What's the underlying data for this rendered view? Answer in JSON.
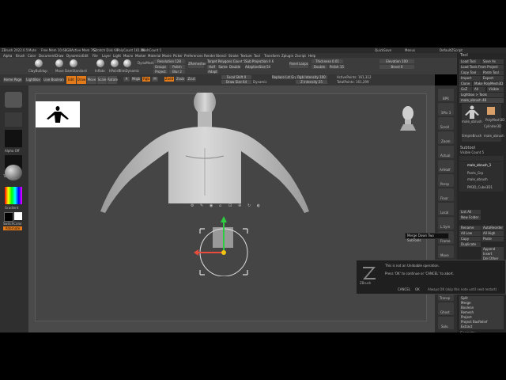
{
  "title_bar": {
    "app": "ZBrush 2022.0.5",
    "items": [
      "Mute",
      "Free Mem 10.68GB",
      "Active Mem 763",
      "Scratch Disk 69",
      "PolyCount 161.5K",
      "MeshCount 1"
    ],
    "right_items": [
      "QuickSave",
      "Menus",
      "DefaultZScript"
    ]
  },
  "menu_bar": {
    "items": [
      "Alpha",
      "Brush",
      "Color",
      "Document",
      "Draw",
      "Dynamics",
      "Edit",
      "File",
      "Layer",
      "Light",
      "Macro",
      "Marker",
      "Material",
      "Movie",
      "Picker",
      "Preferences",
      "Render",
      "Stencil",
      "Stroke",
      "Texture",
      "Tool",
      "Transform",
      "Zplugin",
      "Zscript",
      "Help"
    ]
  },
  "top_toolbar": {
    "brushes": [
      "ClayBuildup",
      "Move",
      "DamStandard",
      "Inflate",
      "hPolish",
      "TrimDynamic"
    ],
    "brush_mode": "DynaMesh",
    "resolution_label": "Resolution 128",
    "polish": "Polish",
    "blur": "Blur 2",
    "groups": "Groups",
    "project": "Project",
    "sub_projection": "Sub Projection 0.6",
    "zremesher": "ZRemesher",
    "target_polygons": "Target Polygons Count 5",
    "half": "Half",
    "same": "Same",
    "double": "Double",
    "adapt": "Adapt",
    "adaptive_size": "AdaptiveSize 50",
    "panel_loops": "Panel Loops",
    "thickness": "Thickness 0.01",
    "polish_slider": "Polish 15",
    "elevation": "Elevation 100",
    "double_sided": "Double",
    "bevel": "Bevel 0"
  },
  "sub_toolbar": {
    "home_page": "Home Page",
    "lightbox": "LightBox",
    "live_boolean": "Live Boolean",
    "edit": "Edit",
    "draw": "Draw",
    "move": "Move",
    "scale": "Scale",
    "rotate": "Rotate",
    "a": "A",
    "mrgb": "Mrgb",
    "rgb": "Rgb",
    "m": "M",
    "zadd": "Zadd",
    "zsub": "Zsub",
    "zcut": "Zcut",
    "focal_shift": "Focal Shift 0",
    "draw_size": "Draw Size 64",
    "dynamic": "Dynamic",
    "rgb_intensity": "Rgb Intensity 100",
    "z_intensity": "Z Intensity 25",
    "active_points": "ActivePoints: 161,312",
    "total_points": "TotalPoints: 161,299",
    "replace_list": "Replace Lst Grp",
    "switch_msg": "Switching to Subtool 2 : male_obrush"
  },
  "left_shelf": {
    "labels": [
      "Alpha Off",
      "Texture Off",
      "Gradient",
      "SwitchColor",
      "Alternate"
    ],
    "accent_color": "#e37b1a"
  },
  "right_shelf": {
    "labels": [
      "BPR",
      "SPix 3",
      "Scroll",
      "Zoom",
      "Actual",
      "AAHalf",
      "Persp",
      "Floor",
      "Local",
      "L.Sym",
      "Frame",
      "Move",
      "Zoom3D",
      "Rotate",
      "Transp",
      "Ghost",
      "Solo",
      "Xpose"
    ]
  },
  "right_panel": {
    "header": "Tool",
    "rows": [
      "Load Tool",
      "Save As",
      "Load Tools From Project",
      "Copy Tool",
      "Paste Tool",
      "Import",
      "Export",
      "Clone",
      "Make PolyMesh3D",
      "GoZ",
      "All",
      "Visible",
      "Lightbox > Tools",
      "male_obrush 48"
    ],
    "tool_thumbs": [
      "male_obrush",
      "PolyMesh3D",
      "Cylinder3D",
      "SimpleBrush",
      "male_obrush"
    ],
    "subtool_header": "Subtool",
    "visible_count": "Visible Count 5",
    "subtools": [
      "male_obrush_1",
      "Pants_Grp",
      "male_obrush",
      "PM3D_Cube3D1"
    ],
    "list_all": "List All",
    "new_folder": "New Folder",
    "rows2": [
      "Rename",
      "AutoReorder",
      "All Low",
      "All High",
      "Copy",
      "Paste",
      "Duplicate",
      "Append",
      "Insert",
      "Del Other",
      "Delete"
    ],
    "rows3": [
      "Split",
      "Merge",
      "Boolean",
      "Remesh",
      "Project",
      "Project BasRelief",
      "Extract"
    ],
    "geometry": "Geometry"
  },
  "viewport": {
    "gizmo_icons": [
      "gear-icon",
      "pin-icon",
      "location-icon",
      "home-icon",
      "lock-icon",
      "transform-icon",
      "refresh-icon",
      "mask-icon"
    ]
  },
  "tooltip": {
    "text": "Merge Down Two SubTools"
  },
  "dialog": {
    "line1": "This is not an Undoable operation.",
    "line2": "Press 'OK' to continue or 'CANCEL' to abort.",
    "cancel": "CANCEL",
    "ok": "OK",
    "always": "Always OK (skip this note until next restart)",
    "logo": "ZBrush"
  }
}
